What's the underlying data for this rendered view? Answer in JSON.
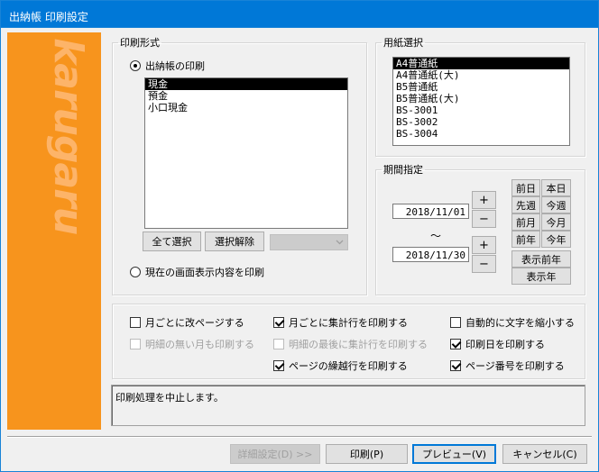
{
  "window": {
    "title": "出納帳 印刷設定"
  },
  "brand": {
    "logo_text": "karugaru",
    "band_color": "#f7941d"
  },
  "print_format": {
    "legend": "印刷形式",
    "radio_ledger_label": "出納帳の印刷",
    "radio_ledger_selected": true,
    "list_items": [
      "現金",
      "預金",
      "小口現金"
    ],
    "list_selected": "現金",
    "select_all_label": "全て選択",
    "deselect_label": "選択解除",
    "combo_value": "",
    "radio_screen_label": "現在の画面表示内容を印刷",
    "radio_screen_selected": false
  },
  "paper": {
    "legend": "用紙選択",
    "items": [
      "A4普通紙",
      "A4普通紙(大)",
      "B5普通紙",
      "B5普通紙(大)",
      "BS-3001",
      "BS-3002",
      "BS-3004"
    ],
    "selected": "A4普通紙"
  },
  "period": {
    "legend": "期間指定",
    "start_date": "2018/11/01",
    "end_date": "2018/11/30",
    "separator": "～",
    "plus_label": "+",
    "minus_label": "−",
    "quick_buttons": {
      "prev_day": "前日",
      "today": "本日",
      "prev_week": "先週",
      "this_week": "今週",
      "prev_month": "前月",
      "this_month": "今月",
      "prev_year": "前年",
      "this_year": "今年",
      "display_prev_year": "表示前年",
      "display_year": "表示年"
    }
  },
  "options": {
    "new_page_per_month": {
      "label": "月ごとに改ページする",
      "checked": false,
      "enabled": true
    },
    "print_monthly_total": {
      "label": "月ごとに集計行を印刷する",
      "checked": true,
      "enabled": true
    },
    "auto_shrink_text": {
      "label": "自動的に文字を縮小する",
      "checked": false,
      "enabled": true
    },
    "print_empty_months": {
      "label": "明細の無い月も印刷する",
      "checked": false,
      "enabled": false
    },
    "print_total_at_end": {
      "label": "明細の最後に集計行を印刷する",
      "checked": false,
      "enabled": false
    },
    "print_date": {
      "label": "印刷日を印刷する",
      "checked": true,
      "enabled": true
    },
    "print_carryover": {
      "label": "ページの繰越行を印刷する",
      "checked": true,
      "enabled": true
    },
    "print_page_number": {
      "label": "ページ番号を印刷する",
      "checked": true,
      "enabled": true
    }
  },
  "status": {
    "message": "印刷処理を中止します。"
  },
  "footer": {
    "details_label": "詳細設定(D) >>",
    "print_label": "印刷(P)",
    "preview_label": "プレビュー(V)",
    "cancel_label": "キャンセル(C)"
  }
}
